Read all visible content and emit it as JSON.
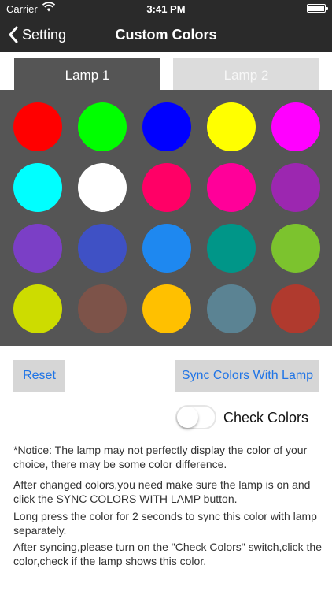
{
  "status_bar": {
    "carrier": "Carrier",
    "time": "3:41 PM",
    "battery_level": 1.0
  },
  "nav": {
    "back_label": "Setting",
    "title": "Custom Colors"
  },
  "tabs": [
    {
      "label": "Lamp 1",
      "selected": true
    },
    {
      "label": "Lamp 2",
      "selected": false
    }
  ],
  "palette": {
    "background": "#555555",
    "colors": [
      "#ff0000",
      "#00ff00",
      "#0000ff",
      "#ffff00",
      "#ff00ff",
      "#00ffff",
      "#ffffff",
      "#ff0066",
      "#ff0099",
      "#9c27b0",
      "#7b3fc6",
      "#3f51c5",
      "#1e88f0",
      "#009688",
      "#7cc32e",
      "#cddc00",
      "#7d5349",
      "#ffc000",
      "#5b8393",
      "#b03a2e"
    ]
  },
  "buttons": {
    "reset_label": "Reset",
    "sync_label": "Sync Colors With Lamp"
  },
  "check_colors": {
    "label": "Check Colors",
    "on": false
  },
  "notes": [
    "*Notice: The lamp may not perfectly display the color of your choice, there may be some color difference.",
    "After changed colors,you need make sure the lamp is on and click the SYNC COLORS WITH LAMP button.",
    "Long press the color for 2 seconds to sync this color with lamp separately.",
    "After syncing,please turn on the \"Check Colors\" switch,click the color,check if the lamp shows this color."
  ],
  "colors": {
    "accent": "#1f74e6",
    "bar_background": "#2a2a2a",
    "button_background": "#d6d6d6"
  }
}
